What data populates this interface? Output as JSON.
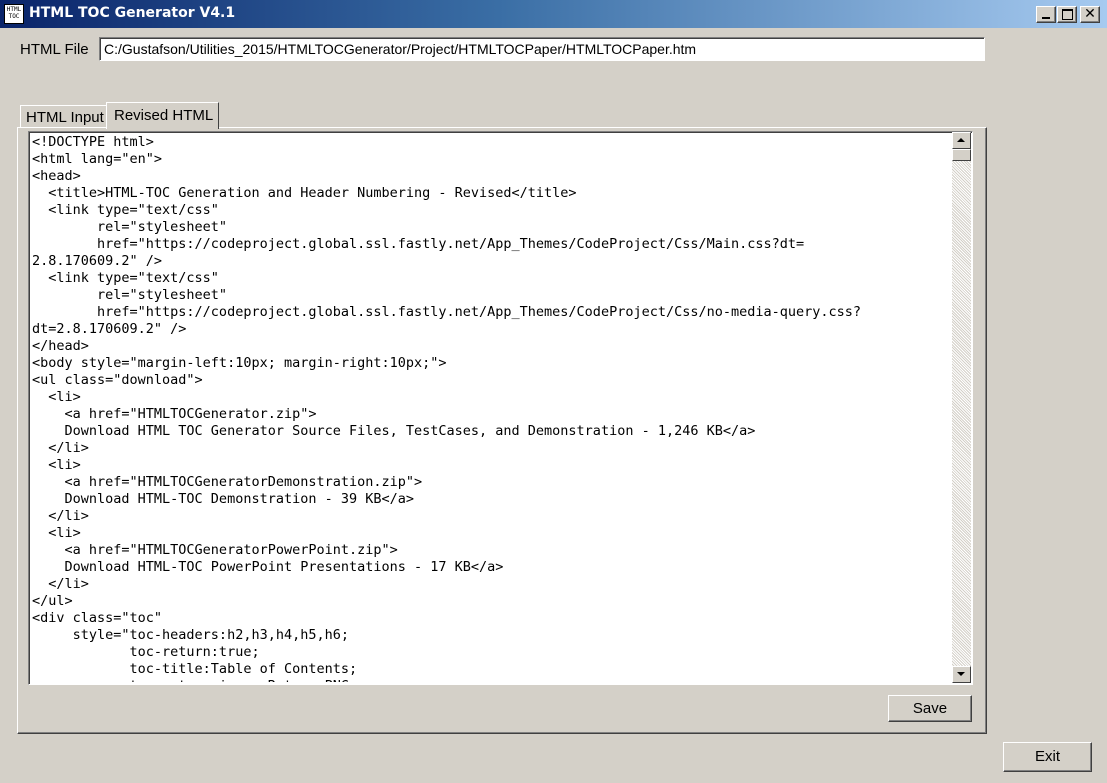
{
  "window": {
    "title": "HTML TOC Generator V4.1",
    "icon_text": "HTML\nTOC",
    "controls": {
      "minimize_icon": "minimize-icon",
      "maximize_icon": "maximize-icon",
      "close_glyph": "✕"
    }
  },
  "file_row": {
    "label": "HTML File",
    "path": "C:/Gustafson/Utilities_2015/HTMLTOCGenerator/Project/HTMLTOCPaper/HTMLTOCPaper.htm"
  },
  "tabs": [
    {
      "label": "HTML Input",
      "selected": false
    },
    {
      "label": "Revised HTML",
      "selected": true
    }
  ],
  "code_view": {
    "text": "<!DOCTYPE html>\n<html lang=\"en\">\n<head>\n  <title>HTML-TOC Generation and Header Numbering - Revised</title>\n  <link type=\"text/css\"\n        rel=\"stylesheet\"\n        href=\"https://codeproject.global.ssl.fastly.net/App_Themes/CodeProject/Css/Main.css?dt=\n2.8.170609.2\" />\n  <link type=\"text/css\"\n        rel=\"stylesheet\"\n        href=\"https://codeproject.global.ssl.fastly.net/App_Themes/CodeProject/Css/no-media-query.css?\ndt=2.8.170609.2\" />\n</head>\n<body style=\"margin-left:10px; margin-right:10px;\">\n<ul class=\"download\">\n  <li>\n    <a href=\"HTMLTOCGenerator.zip\">\n    Download HTML TOC Generator Source Files, TestCases, and Demonstration - 1,246 KB</a>\n  </li>\n  <li>\n    <a href=\"HTMLTOCGeneratorDemonstration.zip\">\n    Download HTML-TOC Demonstration - 39 KB</a>\n  </li>\n  <li>\n    <a href=\"HTMLTOCGeneratorPowerPoint.zip\">\n    Download HTML-TOC PowerPoint Presentations - 17 KB</a>\n  </li>\n</ul>\n<div class=\"toc\"\n     style=\"toc-headers:h2,h3,h4,h5,h6;\n            toc-return:true;\n            toc-title:Table of Contents;\n            toc-return-image:Return.PNG;"
  },
  "buttons": {
    "save_label": "Save",
    "exit_label": "Exit"
  }
}
